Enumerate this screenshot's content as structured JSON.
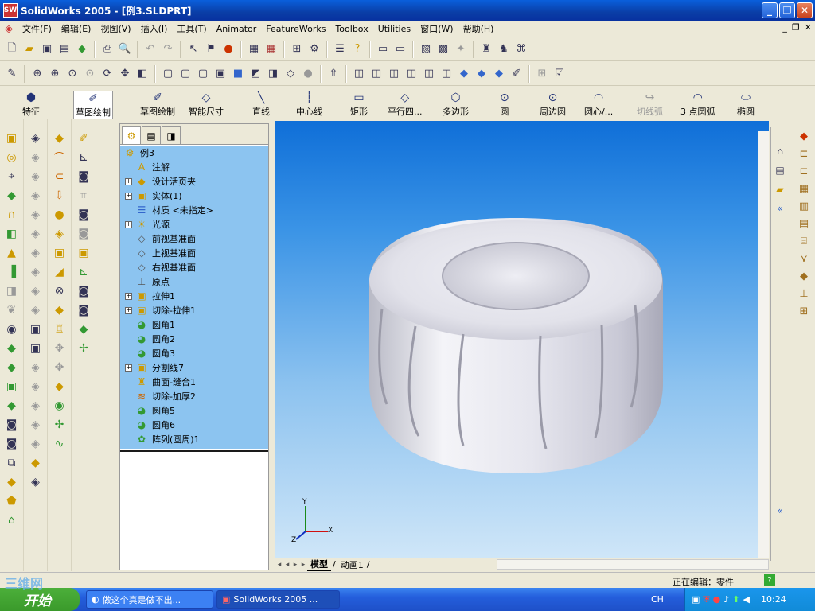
{
  "window": {
    "title": "SolidWorks 2005 - [例3.SLDPRT]",
    "app_icon": "solidworks-icon"
  },
  "menu": [
    "文件(F)",
    "编辑(E)",
    "视图(V)",
    "插入(I)",
    "工具(T)",
    "Animator",
    "FeatureWorks",
    "Toolbox",
    "Utilities",
    "窗口(W)",
    "帮助(H)"
  ],
  "sketch_toolbar": {
    "feature_tab": "特征",
    "sketch_tab": "草图绘制",
    "tools": [
      "草图绘制",
      "智能尺寸",
      "直线",
      "中心线",
      "矩形",
      "平行四...",
      "多边形",
      "圆",
      "周边圆",
      "圆心/...",
      "切线弧",
      "3 点圆弧",
      "椭圆"
    ]
  },
  "feature_tree": {
    "root": "例3",
    "items": [
      {
        "label": "注解",
        "expandable": false,
        "icon": "annotation-icon"
      },
      {
        "label": "设计活页夹",
        "expandable": true,
        "icon": "binder-icon"
      },
      {
        "label": "实体(1)",
        "expandable": true,
        "icon": "solid-body-icon"
      },
      {
        "label": "材质 <未指定>",
        "expandable": false,
        "icon": "material-icon"
      },
      {
        "label": "光源",
        "expandable": true,
        "icon": "lights-icon"
      },
      {
        "label": "前视基准面",
        "expandable": false,
        "icon": "plane-icon"
      },
      {
        "label": "上视基准面",
        "expandable": false,
        "icon": "plane-icon"
      },
      {
        "label": "右视基准面",
        "expandable": false,
        "icon": "plane-icon"
      },
      {
        "label": "原点",
        "expandable": false,
        "icon": "origin-icon"
      },
      {
        "label": "拉伸1",
        "expandable": true,
        "icon": "extrude-icon"
      },
      {
        "label": "切除-拉伸1",
        "expandable": true,
        "icon": "cut-extrude-icon"
      },
      {
        "label": "圆角1",
        "expandable": false,
        "icon": "fillet-icon"
      },
      {
        "label": "圆角2",
        "expandable": false,
        "icon": "fillet-icon"
      },
      {
        "label": "圆角3",
        "expandable": false,
        "icon": "fillet-icon"
      },
      {
        "label": "分割线7",
        "expandable": true,
        "icon": "split-line-icon"
      },
      {
        "label": "曲面-缝合1",
        "expandable": false,
        "icon": "knit-surface-icon"
      },
      {
        "label": "切除-加厚2",
        "expandable": false,
        "icon": "thicken-cut-icon"
      },
      {
        "label": "圆角5",
        "expandable": false,
        "icon": "fillet-icon"
      },
      {
        "label": "圆角6",
        "expandable": false,
        "icon": "fillet-icon"
      },
      {
        "label": "阵列(圆周)1",
        "expandable": false,
        "icon": "circular-pattern-icon"
      }
    ]
  },
  "viewport": {
    "axes": {
      "x": "X",
      "y": "Y",
      "z": "Z"
    }
  },
  "model_tabs": [
    "模型",
    "动画1"
  ],
  "status": {
    "editing": "正在编辑：零件"
  },
  "taskbar": {
    "start": "开始",
    "items": [
      "做这个真是做不出...",
      "SolidWorks 2005 ..."
    ],
    "ime": "CH",
    "clock": "10:24"
  },
  "watermark": "三维网"
}
